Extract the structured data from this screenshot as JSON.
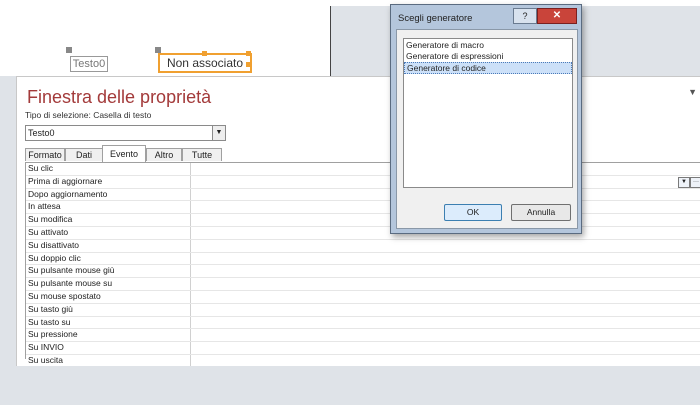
{
  "design": {
    "label_text": "Testo0",
    "textbox_text": "Non associato"
  },
  "props": {
    "title": "Finestra delle proprietà",
    "selection_type": "Tipo di selezione:  Casella di testo",
    "object_combo": "Testo0",
    "close_glyph": "▼",
    "tabs": [
      "Formato",
      "Dati",
      "Evento",
      "Altro",
      "Tutte"
    ],
    "active_tab": "Evento",
    "rows": [
      "Su clic",
      "Prima di aggiornare",
      "Dopo aggiornamento",
      "In attesa",
      "Su modifica",
      "Su attivato",
      "Su disattivato",
      "Su doppio clic",
      "Su pulsante mouse giù",
      "Su pulsante mouse su",
      "Su mouse spostato",
      "Su tasto giù",
      "Su tasto su",
      "Su pressione",
      "Su INVIO",
      "Su uscita"
    ],
    "row_dropdown_glyph": "▼",
    "row_build_glyph": "···"
  },
  "dialog": {
    "title": "Scegli generatore",
    "help_glyph": "?",
    "close_glyph": "✕",
    "items": [
      "Generatore di macro",
      "Generatore di espressioni",
      "Generatore di codice"
    ],
    "selected_item": "Generatore di codice",
    "ok_label": "OK",
    "cancel_label": "Annulla"
  }
}
